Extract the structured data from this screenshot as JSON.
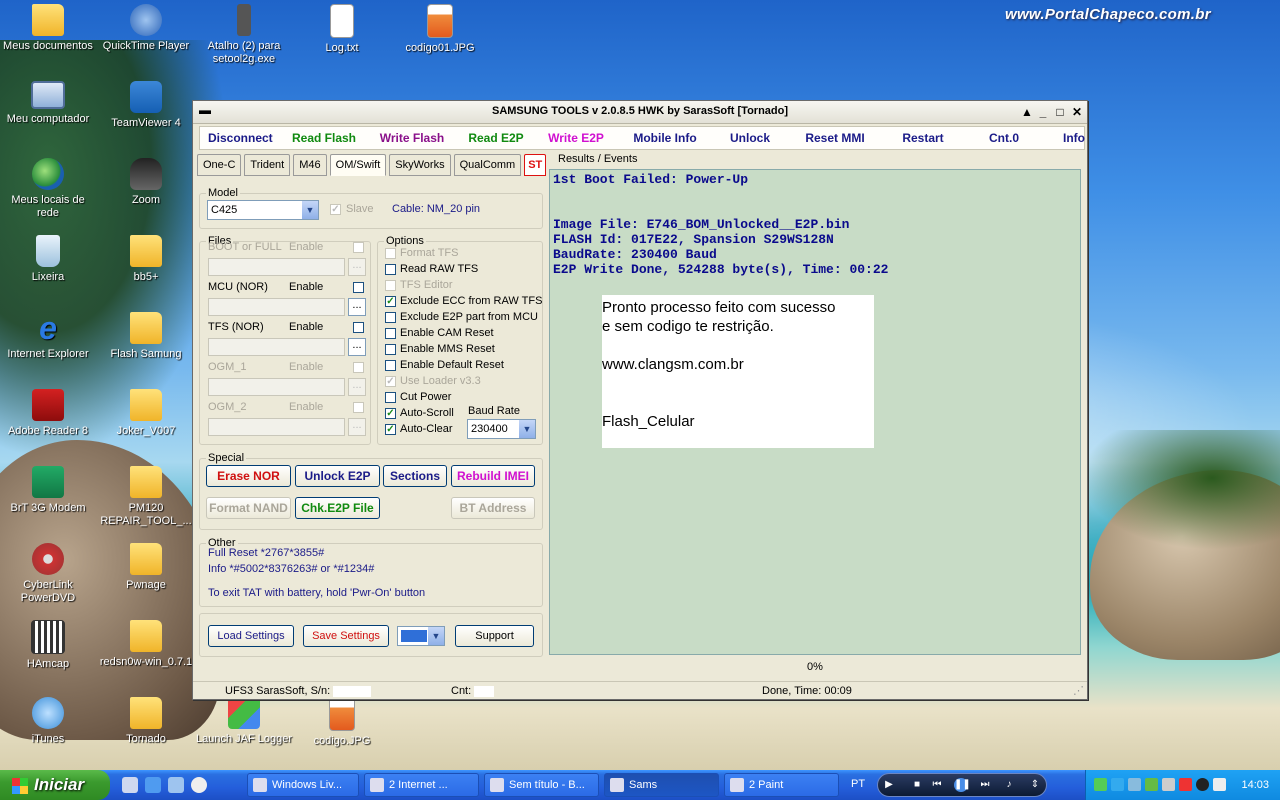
{
  "desktop": {
    "watermark": "www.PortalChapeco.com.br",
    "icons": [
      {
        "label": "Meus documentos",
        "icon": "folder-doc-icon"
      },
      {
        "label": "QuickTime Player",
        "icon": "quicktime-icon"
      },
      {
        "label": "Atalho (2) para setool2g.exe",
        "icon": "phone-icon"
      },
      {
        "label": "Log.txt",
        "icon": "text-file-icon"
      },
      {
        "label": "codigo01.JPG",
        "icon": "image-file-icon"
      },
      {
        "label": "Meu computador",
        "icon": "computer-icon"
      },
      {
        "label": "TeamViewer 4",
        "icon": "teamviewer-icon"
      },
      {
        "label": "Meus locais de rede",
        "icon": "network-icon"
      },
      {
        "label": "Zoom",
        "icon": "binoculars-icon"
      },
      {
        "label": "Lixeira",
        "icon": "recycle-bin-icon"
      },
      {
        "label": "bb5+",
        "icon": "folder-icon"
      },
      {
        "label": "Internet Explorer",
        "icon": "ie-icon"
      },
      {
        "label": "Flash Samung",
        "icon": "folder-icon"
      },
      {
        "label": "Adobe Reader 8",
        "icon": "pdf-icon"
      },
      {
        "label": "Joker_V007",
        "icon": "folder-icon"
      },
      {
        "label": "BrT 3G Modem",
        "icon": "modem-icon"
      },
      {
        "label": "PM120 REPAIR_TOOL_...",
        "icon": "folder-icon"
      },
      {
        "label": "CyberLink PowerDVD",
        "icon": "dvd-icon"
      },
      {
        "label": "Pwnage",
        "icon": "folder-icon"
      },
      {
        "label": "HAmcap",
        "icon": "hamcap-icon"
      },
      {
        "label": "redsn0w-win_0.7.1",
        "icon": "folder-icon"
      },
      {
        "label": "iTunes",
        "icon": "itunes-icon"
      },
      {
        "label": "Tornado",
        "icon": "folder-icon"
      },
      {
        "label": "Launch JAF Logger",
        "icon": "jaf-icon"
      },
      {
        "label": "codigo.JPG",
        "icon": "image-file-icon"
      }
    ]
  },
  "window": {
    "title": "SAMSUNG TOOLS v 2.0.8.5 HWK by SarasSoft  [Tornado]",
    "menu": [
      {
        "label": "Disconnect",
        "color": "#1b1b88"
      },
      {
        "label": "Read Flash",
        "color": "#108a10"
      },
      {
        "label": "Write Flash",
        "color": "#8a108a"
      },
      {
        "label": "Read E2P",
        "color": "#108a10"
      },
      {
        "label": "Write E2P",
        "color": "#d010d0"
      },
      {
        "label": "Mobile Info",
        "color": "#1b1b88"
      },
      {
        "label": "Unlock",
        "color": "#1b1b88"
      },
      {
        "label": "Reset MMI",
        "color": "#1b1b88"
      },
      {
        "label": "Restart",
        "color": "#1b1b88"
      },
      {
        "label": "Cnt.0",
        "color": "#1b1b88"
      },
      {
        "label": "Info",
        "color": "#1b1b88"
      }
    ],
    "tabs": [
      "One-C",
      "Trident",
      "M46",
      "OM/Swift",
      "SkyWorks",
      "QualComm",
      "ST"
    ],
    "active_tab": "OM/Swift",
    "model": {
      "legend": "Model",
      "value": "C425",
      "slave_label": "Slave",
      "slave_checked": true,
      "cable": "Cable: NM_20 pin"
    },
    "files": {
      "legend": "Files",
      "enable_label": "Enable",
      "browse": "...",
      "rows": [
        {
          "label": "BOOT or FULL",
          "checked": false,
          "enabled": false
        },
        {
          "label": "MCU (NOR)",
          "checked": false,
          "enabled": true
        },
        {
          "label": "TFS (NOR)",
          "checked": false,
          "enabled": true
        },
        {
          "label": "OGM_1",
          "checked": false,
          "enabled": false
        },
        {
          "label": "OGM_2",
          "checked": false,
          "enabled": false
        }
      ]
    },
    "options": {
      "legend": "Options",
      "items": [
        {
          "label": "Format TFS",
          "checked": false,
          "enabled": false
        },
        {
          "label": "Read RAW TFS",
          "checked": false,
          "enabled": true
        },
        {
          "label": "TFS Editor",
          "checked": false,
          "enabled": false
        },
        {
          "label": "Exclude ECC from RAW TFS",
          "checked": true,
          "enabled": true
        },
        {
          "label": "Exclude E2P part from MCU",
          "checked": false,
          "enabled": true
        },
        {
          "label": "Enable CAM Reset",
          "checked": false,
          "enabled": true
        },
        {
          "label": "Enable MMS Reset",
          "checked": false,
          "enabled": true
        },
        {
          "label": "Enable Default Reset",
          "checked": false,
          "enabled": true
        },
        {
          "label": "Use Loader v3.3",
          "checked": true,
          "enabled": false
        },
        {
          "label": "Cut Power",
          "checked": false,
          "enabled": true
        },
        {
          "label": "Auto-Scroll",
          "checked": true,
          "enabled": true
        },
        {
          "label": "Auto-Clear",
          "checked": true,
          "enabled": true
        }
      ],
      "baud_label": "Baud Rate",
      "baud_value": "230400"
    },
    "special": {
      "legend": "Special",
      "erase_nor": "Erase NOR",
      "unlock_e2p": "Unlock E2P",
      "sections": "Sections",
      "rebuild_imei": "Rebuild IMEI",
      "format_nand": "Format NAND",
      "chk_e2p": "Chk.E2P File",
      "bt_address": "BT Address"
    },
    "other": {
      "legend": "Other",
      "full_reset": "Full Reset  *2767*3855#",
      "info": "Info  *#5002*8376263#  or *#1234#",
      "exit_tat": "To exit TAT with battery, hold 'Pwr-On' button"
    },
    "footer": {
      "load_settings": "Load Settings",
      "save_settings": "Save Settings",
      "support": "Support",
      "color_swatch": "#2f6fd8"
    },
    "results": {
      "label": "Results / Events",
      "lines": [
        "1st Boot Failed: Power-Up",
        "",
        "",
        "Image File: E746_BOM_Unlocked__E2P.bin",
        "FLASH Id: 017E22, Spansion S29WS128N",
        "BaudRate: 230400 Baud",
        "E2P Write Done, 524288 byte(s), Time: 00:22"
      ],
      "note": [
        "Pronto processo feito com sucesso",
        "e sem codigo te restrição.",
        "",
        "www.clangsm.com.br",
        "",
        "",
        "Flash_Celular"
      ]
    },
    "progress": "0%",
    "status": {
      "serial": "UFS3 SarasSoft, S/n:",
      "cnt": "Cnt:",
      "done": "Done, Time: 00:09"
    }
  },
  "taskbar": {
    "start_label": "Iniciar",
    "tasks": [
      {
        "label": "Windows Liv...",
        "active": false
      },
      {
        "label": "2 Internet ...",
        "active": false
      },
      {
        "label": "Sem título - B...",
        "active": false
      },
      {
        "label": "Sams",
        "active": true
      },
      {
        "label": "2 Paint",
        "active": false
      }
    ],
    "language": "PT",
    "clock": "14:03"
  }
}
